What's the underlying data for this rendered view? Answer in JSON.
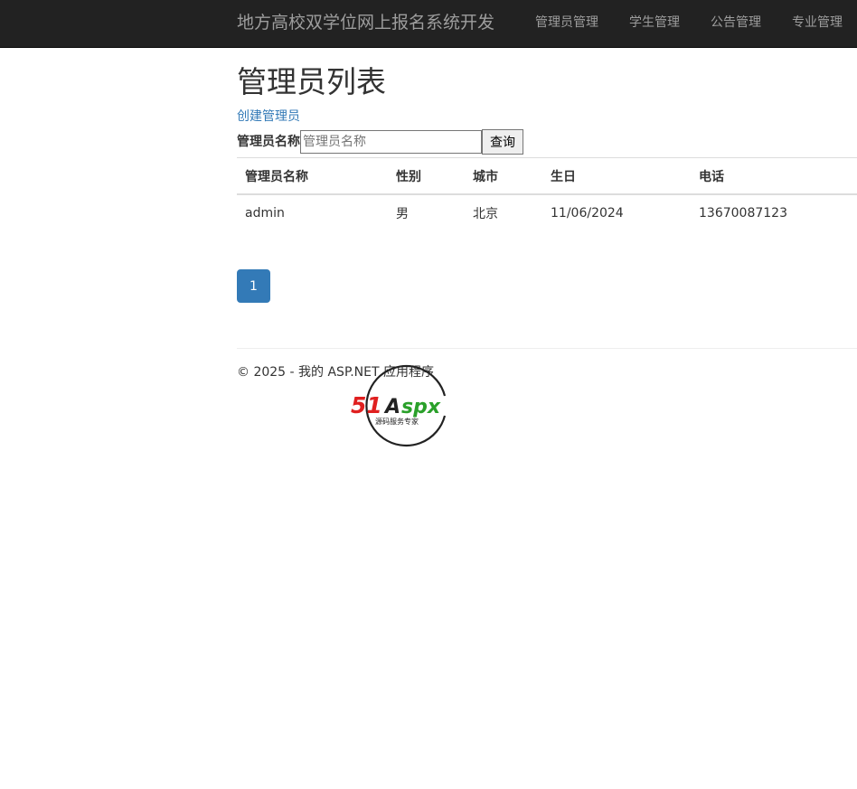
{
  "navbar": {
    "brand": "地方高校双学位网上报名系统开发",
    "items": [
      "管理员管理",
      "学生管理",
      "公告管理",
      "专业管理"
    ]
  },
  "page": {
    "title": "管理员列表",
    "create_link": "创建管理员"
  },
  "search": {
    "label": "管理员名称",
    "placeholder": "管理员名称",
    "button": "查询"
  },
  "table": {
    "headers": [
      "管理员名称",
      "性别",
      "城市",
      "生日",
      "电话"
    ],
    "rows": [
      [
        "admin",
        "男",
        "北京",
        "11/06/2024",
        "13670087123"
      ]
    ]
  },
  "pagination": {
    "pages": [
      "1"
    ],
    "active": "1"
  },
  "footer": {
    "text": "© 2025 - 我的 ASP.NET 应用程序"
  },
  "watermark": {
    "brand": "51Aspx",
    "tagline": "源码服务专家",
    "colors": {
      "red": "#e02020",
      "green": "#2aa02a",
      "dark": "#222222"
    }
  }
}
